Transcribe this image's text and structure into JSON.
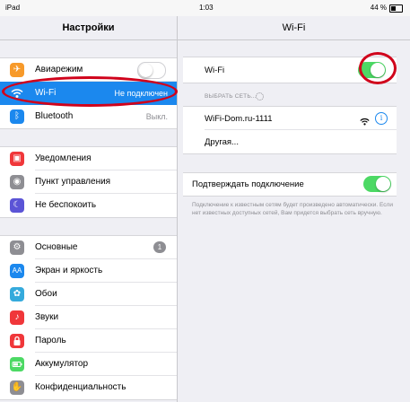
{
  "status_bar": {
    "device": "iPad",
    "time": "1:03",
    "battery_text": "44 %",
    "battery_level": 0.44
  },
  "settings_panel": {
    "title": "Настройки",
    "groups": [
      [
        {
          "label": "Авиарежим",
          "icon": "airplane-icon",
          "icon_color": "#f79a2a",
          "control": "toggle-off"
        },
        {
          "label": "Wi-Fi",
          "icon": "wifi-icon",
          "icon_color": "#1b88ee",
          "value": "Не подключен",
          "selected": true
        },
        {
          "label": "Bluetooth",
          "icon": "bluetooth-icon",
          "icon_color": "#1b88ee",
          "value": "Выкл."
        }
      ],
      [
        {
          "label": "Уведомления",
          "icon": "notifications-icon",
          "icon_color": "#f0373a"
        },
        {
          "label": "Пункт управления",
          "icon": "control-center-icon",
          "icon_color": "#8e8e93"
        },
        {
          "label": "Не беспокоить",
          "icon": "moon-icon",
          "icon_color": "#5b54d6"
        }
      ],
      [
        {
          "label": "Основные",
          "icon": "gear-icon",
          "icon_color": "#8e8e93",
          "badge": "1"
        },
        {
          "label": "Экран и яркость",
          "icon": "display-icon",
          "icon_color": "#1b88ee"
        },
        {
          "label": "Обои",
          "icon": "wallpaper-icon",
          "icon_color": "#35aadc"
        },
        {
          "label": "Звуки",
          "icon": "sound-icon",
          "icon_color": "#f0373a"
        },
        {
          "label": "Пароль",
          "icon": "lock-icon",
          "icon_color": "#f0373a"
        },
        {
          "label": "Аккумулятор",
          "icon": "battery-icon",
          "icon_color": "#4cd964"
        },
        {
          "label": "Конфиденциальность",
          "icon": "hand-icon",
          "icon_color": "#8e8e93"
        }
      ]
    ]
  },
  "wifi_panel": {
    "title": "Wi-Fi",
    "wifi_toggle_label": "Wi-Fi",
    "wifi_enabled": true,
    "choose_network_header": "ВЫБРАТЬ СЕТЬ...",
    "networks": [
      {
        "name": "WiFi-Dom.ru-1111",
        "secured": false
      }
    ],
    "other_label": "Другая...",
    "ask_to_join_label": "Подтверждать подключение",
    "ask_to_join_enabled": true,
    "footnote": "Подключение к известным сетям будет произведено автоматически. Если нет известных доступных сетей, Вам придется выбрать сеть вручную."
  },
  "colors": {
    "accent": "#1b88ee",
    "toggle_on": "#4cd964",
    "annotation_red": "#d0021b"
  }
}
